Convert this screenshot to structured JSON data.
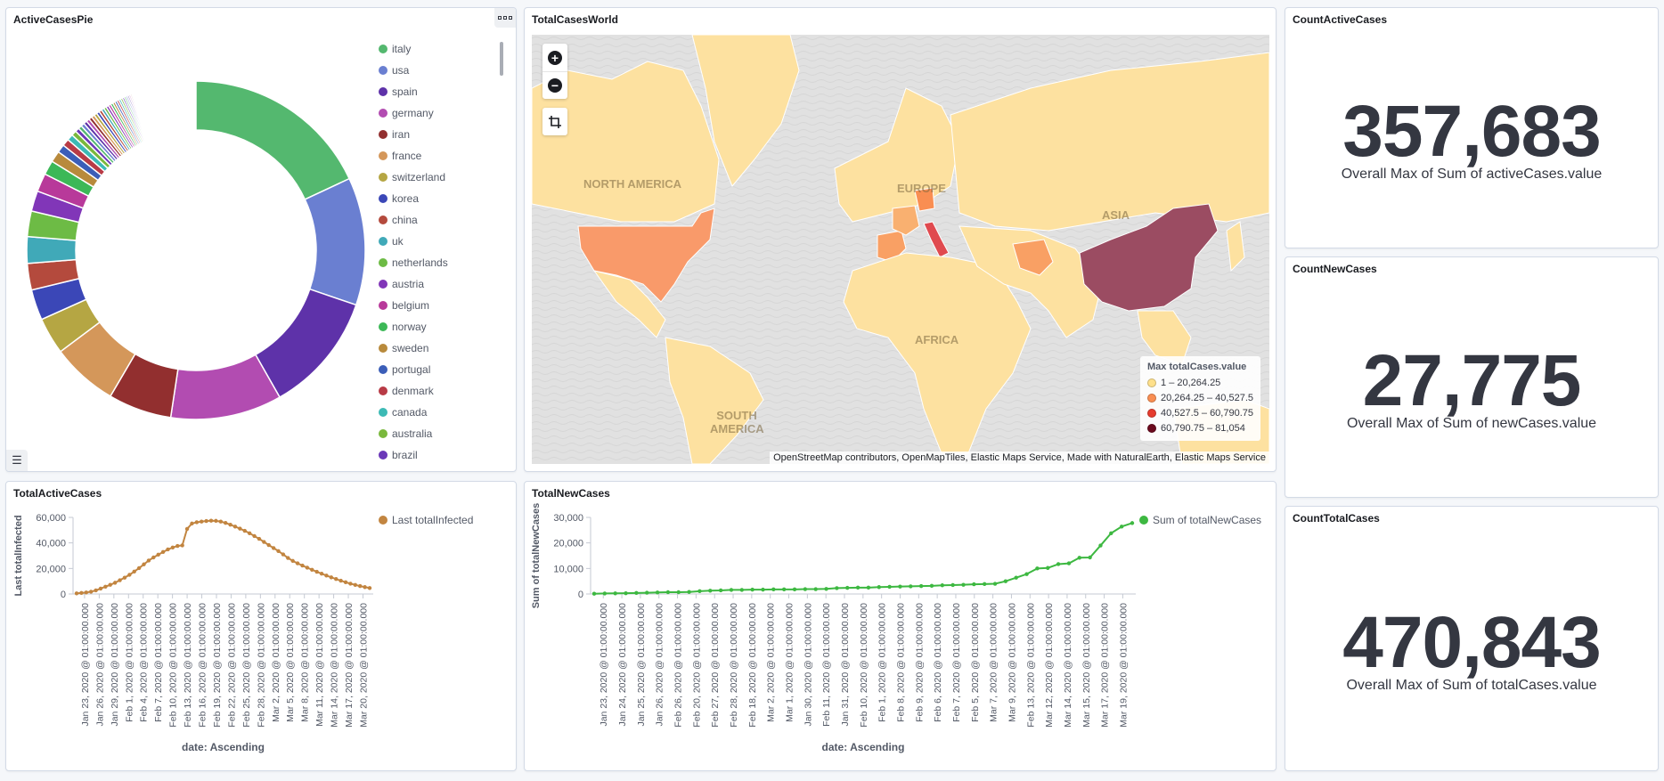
{
  "panels": {
    "pie": {
      "title": "ActiveCasesPie"
    },
    "map": {
      "title": "TotalCasesWorld"
    },
    "active": {
      "title": "CountActiveCases",
      "value": "357,683",
      "label": "Overall Max of Sum of activeCases.value"
    },
    "new": {
      "title": "CountNewCases",
      "value": "27,775",
      "label": "Overall Max of Sum of newCases.value"
    },
    "total": {
      "title": "CountTotalCases",
      "value": "470,843",
      "label": "Overall Max of Sum of totalCases.value"
    },
    "line1": {
      "title": "TotalActiveCases"
    },
    "line2": {
      "title": "TotalNewCases"
    }
  },
  "icons": {
    "options_menu": "ellipsis-icon",
    "legend_toggle": "list-icon",
    "zoom_in": "plus-icon",
    "zoom_out": "minus-icon",
    "fit_bounds": "crop-icon"
  },
  "map": {
    "zoom_in_glyph": "+",
    "zoom_out_glyph": "−",
    "legend_title": "Max totalCases.value",
    "legend": [
      {
        "label": "1 – 20,264.25",
        "color": "#fee08b"
      },
      {
        "label": "20,264.25 – 40,527.5",
        "color": "#f98e52"
      },
      {
        "label": "40,527.5 – 60,790.75",
        "color": "#e63b2e"
      },
      {
        "label": "60,790.75 – 81,054",
        "color": "#6b0a1e"
      }
    ],
    "continents": [
      "NORTH AMERICA",
      "EUROPE",
      "ASIA",
      "AFRICA",
      "SOUTH AMERICA"
    ],
    "attribution": "OpenStreetMap contributors, OpenMapTiles, Elastic Maps Service, Made with NaturalEarth, Elastic Maps Service",
    "colors": {
      "low": "#fde1a0",
      "usa": "#f99a6a",
      "italy": "#e04a4f",
      "china": "#9b4c62",
      "water": "#e1e1e1"
    }
  },
  "chart_data": [
    {
      "type": "pie",
      "title": "ActiveCasesPie",
      "donut": true,
      "legend_position": "right",
      "categories": [
        "italy",
        "usa",
        "spain",
        "germany",
        "iran",
        "france",
        "switzerland",
        "korea",
        "china",
        "uk",
        "netherlands",
        "austria",
        "belgium",
        "norway",
        "sweden",
        "portugal",
        "denmark",
        "canada",
        "australia",
        "brazil"
      ],
      "colors": [
        "#54b86f",
        "#6a7fd1",
        "#5e32a9",
        "#b24cb1",
        "#922f2f",
        "#d4975a",
        "#b5a643",
        "#3b47b7",
        "#b44a3d",
        "#40a9b8",
        "#6dbb45",
        "#8136b8",
        "#b8399a",
        "#3cb857",
        "#b88a3c",
        "#3b5eb8",
        "#b83b46",
        "#3cbab5",
        "#7ab83c",
        "#6b38b8"
      ],
      "values": [
        18.5,
        12.5,
        11.8,
        10.9,
        6.2,
        6.5,
        3.6,
        3.0,
        2.6,
        2.6,
        2.5,
        2.0,
        1.8,
        1.4,
        1.1,
        0.8,
        0.7,
        0.6,
        0.5,
        0.4
      ],
      "other_small_slices": 40
    },
    {
      "type": "line",
      "title": "TotalActiveCases",
      "xlabel": "date: Ascending",
      "ylabel": "Last totalInfected",
      "ylim": [
        0,
        60000
      ],
      "yticks": [
        "0",
        "20,000",
        "40,000",
        "60,000"
      ],
      "color": "#c28540",
      "legend": "Last totalInfected",
      "legend_position": "top-right",
      "tick_labels": [
        "Jan 23, 2020 @ 01:00:00.000",
        "Jan 26, 2020 @ 01:00:00.000",
        "Jan 29, 2020 @ 01:00:00.000",
        "Feb 1, 2020 @ 01:00:00.000",
        "Feb 4, 2020 @ 01:00:00.000",
        "Feb 7, 2020 @ 01:00:00.000",
        "Feb 10, 2020 @ 01:00:00.000",
        "Feb 13, 2020 @ 01:00:00.000",
        "Feb 16, 2020 @ 01:00:00.000",
        "Feb 19, 2020 @ 01:00:00.000",
        "Feb 22, 2020 @ 01:00:00.000",
        "Feb 25, 2020 @ 01:00:00.000",
        "Feb 28, 2020 @ 01:00:00.000",
        "Mar 2, 2020 @ 01:00:00.000",
        "Mar 5, 2020 @ 01:00:00.000",
        "Mar 8, 2020 @ 01:00:00.000",
        "Mar 11, 2020 @ 01:00:00.000",
        "Mar 14, 2020 @ 01:00:00.000",
        "Mar 17, 2020 @ 01:00:00.000",
        "Mar 20, 2020 @ 01:00:00.000"
      ],
      "values": [
        500,
        800,
        1200,
        1800,
        2800,
        4200,
        5700,
        7200,
        8800,
        10800,
        12800,
        15000,
        17600,
        20300,
        23200,
        26200,
        28600,
        30800,
        32900,
        34900,
        36400,
        37600,
        38100,
        51000,
        55200,
        56200,
        56700,
        57200,
        57400,
        57300,
        56700,
        55700,
        54300,
        52800,
        51200,
        49500,
        47600,
        45400,
        43200,
        40800,
        38300,
        36000,
        33600,
        31000,
        28200,
        25900,
        24000,
        22300,
        20600,
        19000,
        17400,
        15900,
        14400,
        13000,
        11700,
        10400,
        9200,
        8100,
        7100,
        6200,
        5400,
        4700
      ]
    },
    {
      "type": "line",
      "title": "TotalNewCases",
      "xlabel": "date: Ascending",
      "ylabel": "Sum of totalNewCases",
      "ylim": [
        0,
        30000
      ],
      "yticks": [
        "0",
        "10,000",
        "20,000",
        "30,000"
      ],
      "color": "#3db841",
      "legend": "Sum of totalNewCases",
      "legend_position": "top-right",
      "tick_labels": [
        "Jan 23, 2020 @ 01:00:00.000",
        "Jan 24, 2020 @ 01:00:00.000",
        "Jan 25, 2020 @ 01:00:00.000",
        "Jan 26, 2020 @ 01:00:00.000",
        "Feb 26, 2020 @ 01:00:00.000",
        "Feb 20, 2020 @ 01:00:00.000",
        "Feb 27, 2020 @ 01:00:00.000",
        "Feb 28, 2020 @ 01:00:00.000",
        "Feb 18, 2020 @ 01:00:00.000",
        "Mar 2, 2020 @ 01:00:00.000",
        "Mar 1, 2020 @ 01:00:00.000",
        "Jan 30, 2020 @ 01:00:00.000",
        "Feb 11, 2020 @ 01:00:00.000",
        "Jan 31, 2020 @ 01:00:00.000",
        "Feb 10, 2020 @ 01:00:00.000",
        "Feb 1, 2020 @ 01:00:00.000",
        "Feb 8, 2020 @ 01:00:00.000",
        "Feb 9, 2020 @ 01:00:00.000",
        "Feb 6, 2020 @ 01:00:00.000",
        "Feb 7, 2020 @ 01:00:00.000",
        "Feb 5, 2020 @ 01:00:00.000",
        "Mar 7, 2020 @ 01:00:00.000",
        "Mar 9, 2020 @ 01:00:00.000",
        "Feb 13, 2020 @ 01:00:00.000",
        "Mar 12, 2020 @ 01:00:00.000",
        "Mar 14, 2020 @ 01:00:00.000",
        "Mar 15, 2020 @ 01:00:00.000",
        "Mar 17, 2020 @ 01:00:00.000",
        "Mar 19, 2020 @ 01:00:00.000"
      ],
      "values": [
        100,
        200,
        250,
        300,
        400,
        500,
        600,
        700,
        700,
        800,
        1100,
        1300,
        1400,
        1600,
        1600,
        1700,
        1700,
        1800,
        1800,
        1800,
        1900,
        1900,
        2000,
        2300,
        2400,
        2500,
        2500,
        2700,
        2800,
        2900,
        3000,
        3100,
        3200,
        3400,
        3500,
        3600,
        3800,
        3900,
        4000,
        5000,
        6400,
        7800,
        10000,
        10200,
        11700,
        12000,
        14200,
        14300,
        19000,
        23800,
        26400,
        27775
      ]
    }
  ]
}
